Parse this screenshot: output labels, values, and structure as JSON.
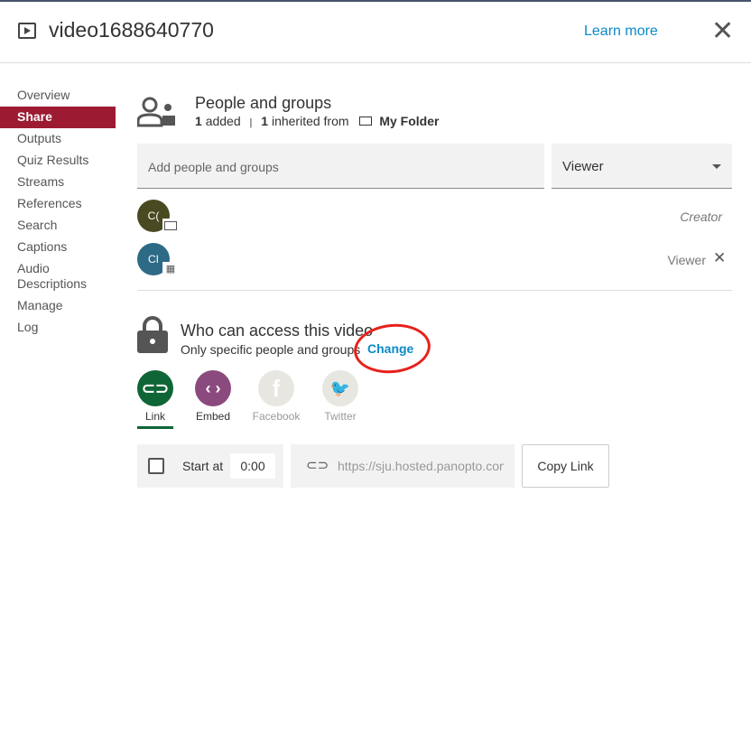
{
  "header": {
    "title": "video1688640770",
    "learn_more": "Learn more",
    "close": "✕"
  },
  "nav": [
    "Overview",
    "Share",
    "Outputs",
    "Quiz Results",
    "Streams",
    "References",
    "Search",
    "Captions",
    "Audio Descriptions",
    "Manage",
    "Log"
  ],
  "active_nav": "Share",
  "people": {
    "title": "People and groups",
    "added_count": "1",
    "added_label": "added",
    "sep": "|",
    "inherited_count": "1",
    "inherited_label": "inherited from",
    "folder": "My Folder",
    "input_placeholder": "Add people and groups",
    "role_select": "Viewer",
    "members": [
      {
        "initials": "C(",
        "role": "Creator",
        "color": "#4a4a22"
      },
      {
        "initials": "CI",
        "role": "Viewer",
        "color": "#2d6a86"
      }
    ]
  },
  "access": {
    "title": "Who can access this video",
    "value": "Only specific people and groups",
    "change": "Change"
  },
  "share_tabs": [
    {
      "label": "Link",
      "color": "#0f6536",
      "glyph": "⊂⊃"
    },
    {
      "label": "Embed",
      "color": "#8b4a7e",
      "glyph": "‹ ›"
    },
    {
      "label": "Facebook",
      "color": "#e7e6e1",
      "glyph": "f"
    },
    {
      "label": "Twitter",
      "color": "#e7e6e1",
      "glyph": "🐦"
    }
  ],
  "link": {
    "start_label": "Start at",
    "start_time": "0:00",
    "url": "https://sju.hosted.panopto.com",
    "copy": "Copy Link"
  }
}
